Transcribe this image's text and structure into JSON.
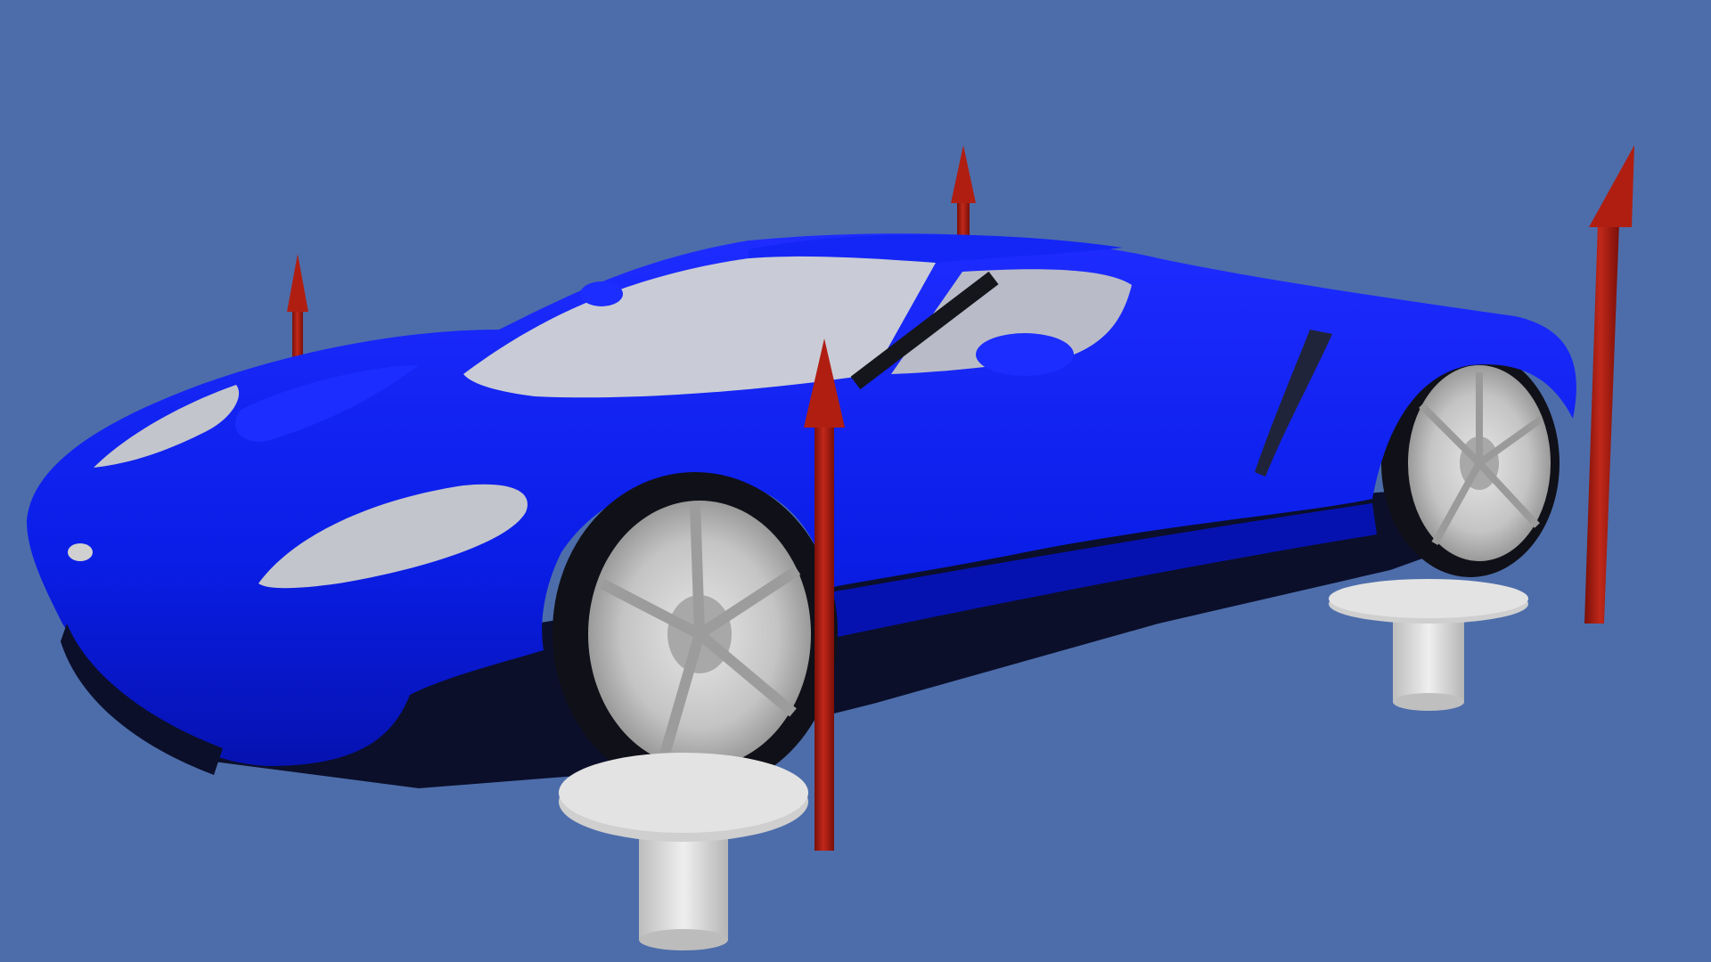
{
  "scene": {
    "background_color": "#4d6daa",
    "body_color": "#0a1ee8",
    "body_shade_color": "#0612b0",
    "underbody_color": "#0b0f2a",
    "glass_color": "#c9ccd6",
    "wheel_color": "#c7c7c7",
    "tire_color": "#101018",
    "pedestal_color": "#d8d8d8",
    "arrow_color": "#a0160c",
    "icons": [
      "car-model",
      "force-arrow",
      "support-pedestal",
      "wheel"
    ]
  }
}
